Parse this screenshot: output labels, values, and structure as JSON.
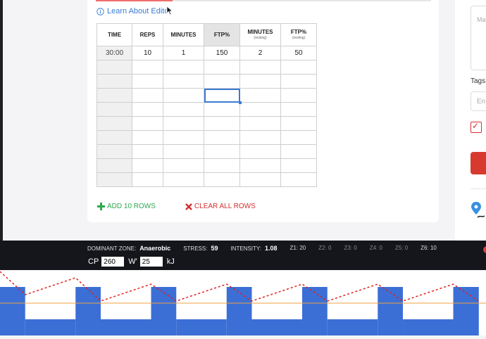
{
  "editor": {
    "progress_percent": 23,
    "learn_link": "Learn About Editor",
    "columns": [
      {
        "label": "TIME",
        "sub": ""
      },
      {
        "label": "REPS",
        "sub": ""
      },
      {
        "label": "MINUTES",
        "sub": ""
      },
      {
        "label": "FTP%",
        "sub": ""
      },
      {
        "label": "MINUTES",
        "sub": "(resting)"
      },
      {
        "label": "FTP%",
        "sub": "(resting)"
      }
    ],
    "rows": [
      [
        "30:00",
        "10",
        "1",
        "150",
        "2",
        "50"
      ],
      [
        "",
        "",
        "",
        "",
        "",
        ""
      ],
      [
        "",
        "",
        "",
        "",
        "",
        ""
      ],
      [
        "",
        "",
        "",
        "",
        "",
        ""
      ],
      [
        "",
        "",
        "",
        "",
        "",
        ""
      ],
      [
        "",
        "",
        "",
        "",
        "",
        ""
      ],
      [
        "",
        "",
        "",
        "",
        "",
        ""
      ],
      [
        "",
        "",
        "",
        "",
        "",
        ""
      ],
      [
        "",
        "",
        "",
        "",
        "",
        ""
      ],
      [
        "",
        "",
        "",
        "",
        "",
        ""
      ]
    ],
    "add_rows_label": "ADD 10 ROWS",
    "clear_rows_label": "CLEAR ALL ROWS"
  },
  "side": {
    "textarea_placeholder": "Ma",
    "tags_label": "Tags",
    "tags_placeholder": "En"
  },
  "stats": {
    "dominant_zone_label": "DOMINANT ZONE:",
    "dominant_zone_value": "Anaerobic",
    "stress_label": "STRESS:",
    "stress_value": "59",
    "intensity_label": "INTENSITY:",
    "intensity_value": "1.08",
    "zones": [
      {
        "label": "Z1: 20",
        "active": true
      },
      {
        "label": "Z2: 0",
        "active": false
      },
      {
        "label": "Z3: 0",
        "active": false
      },
      {
        "label": "Z4: 0",
        "active": false
      },
      {
        "label": "Z5: 0",
        "active": false
      },
      {
        "label": "Z6: 10",
        "active": true
      }
    ],
    "cp_label": "CP",
    "cp_value": "260",
    "wprime_label": "W'",
    "wprime_value": "25",
    "unit": "kJ"
  },
  "chart_data": {
    "type": "area",
    "description_units": "minutes",
    "ftp_percent_levels": {
      "work": 150,
      "rest": 50
    },
    "intervals": [
      {
        "start": 0,
        "duration": 1,
        "ftp": 150
      },
      {
        "start": 1,
        "duration": 2,
        "ftp": 50
      },
      {
        "start": 3,
        "duration": 1,
        "ftp": 150
      },
      {
        "start": 4,
        "duration": 2,
        "ftp": 50
      },
      {
        "start": 6,
        "duration": 1,
        "ftp": 150
      },
      {
        "start": 7,
        "duration": 2,
        "ftp": 50
      },
      {
        "start": 9,
        "duration": 1,
        "ftp": 150
      },
      {
        "start": 10,
        "duration": 2,
        "ftp": 50
      },
      {
        "start": 12,
        "duration": 1,
        "ftp": 150
      },
      {
        "start": 13,
        "duration": 2,
        "ftp": 50
      },
      {
        "start": 15,
        "duration": 1,
        "ftp": 150
      },
      {
        "start": 16,
        "duration": 2,
        "ftp": 50
      },
      {
        "start": 18,
        "duration": 1,
        "ftp": 150
      }
    ],
    "colors": {
      "work": "#3b6fd6",
      "rest": "#ffffff",
      "wprime_line": "#e02020",
      "ftp_line": "#f0a040"
    }
  }
}
